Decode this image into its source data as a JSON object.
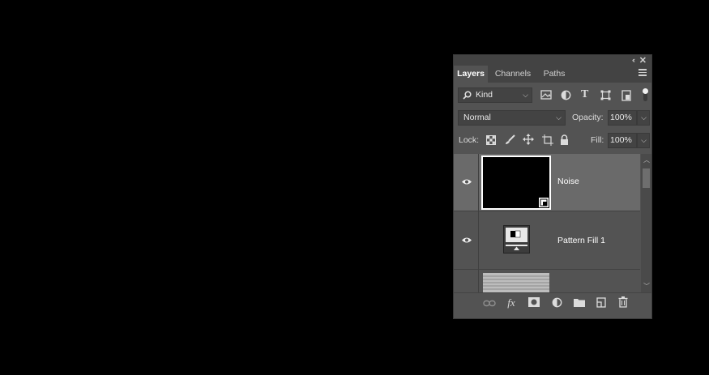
{
  "panel": {
    "collapse_glyph": "‹‹",
    "close_glyph": "✕",
    "tabs": [
      {
        "label": "Layers",
        "active": true
      },
      {
        "label": "Channels",
        "active": false
      },
      {
        "label": "Paths",
        "active": false
      }
    ],
    "filter": {
      "label": "Kind",
      "icons": [
        "image-filter-icon",
        "adjustment-filter-icon",
        "type-filter-icon",
        "shape-filter-icon",
        "smart-object-filter-icon",
        "filter-toggle-icon"
      ],
      "type_glyph": "T"
    },
    "blend_mode": {
      "value": "Normal",
      "opacity_label": "Opacity:",
      "opacity_value": "100%"
    },
    "lock": {
      "label": "Lock:",
      "fill_label": "Fill:",
      "fill_value": "100%"
    },
    "layers": [
      {
        "name": "Noise",
        "selected": true,
        "visible": true
      },
      {
        "name": "Pattern Fill 1",
        "selected": false,
        "visible": true
      },
      {
        "name": "",
        "selected": false,
        "visible": false
      }
    ],
    "footer_icons": [
      "link-layers-icon",
      "fx-icon",
      "add-mask-icon",
      "adjustment-layer-icon",
      "new-group-icon",
      "new-layer-icon",
      "delete-layer-icon"
    ],
    "fx_glyph": "fx"
  },
  "colors": {
    "panel_bg": "#535353",
    "selected_row": "#6a6a6a",
    "canvas_bg": "#000000"
  }
}
